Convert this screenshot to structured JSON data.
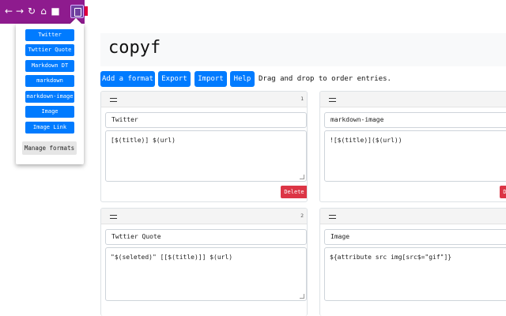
{
  "browser": {
    "icons": [
      "back-arrow-icon",
      "forward-arrow-icon",
      "reload-icon",
      "home-icon",
      "bookmark-icon",
      "extension-icon"
    ],
    "colors": {
      "toolbar": "#8e1b8e"
    }
  },
  "popup": {
    "formats": [
      "Twitter",
      "Twttier Quote",
      "Markdown DT",
      "markdown",
      "markdown-image",
      "Image",
      "Image Link"
    ],
    "manage_label": "Manage formats"
  },
  "page": {
    "title": "copyf"
  },
  "toolbar": {
    "add_label": "Add a format",
    "export_label": "Export",
    "import_label": "Import",
    "help_label": "Help",
    "hint": "Drag and drop to order entries."
  },
  "cards": [
    {
      "index": "1",
      "name": "Twitter",
      "template": "[$(title)] $(url)",
      "delete_label": "Delete"
    },
    {
      "index": "",
      "name": "markdown-image",
      "template": "![$(title)]($(url))",
      "delete_label": "Delete"
    },
    {
      "index": "2",
      "name": "Twttier Quote",
      "template": "\"$(seleted)\" [[$(title)]] $(url)",
      "delete_label": ""
    },
    {
      "index": "",
      "name": "Image",
      "template": "${attribute src img[src$=\"gif\"]}",
      "delete_label": ""
    }
  ],
  "colors": {
    "primary": "#007bff",
    "danger": "#dc3545",
    "secondary": "#e6e6e6"
  }
}
